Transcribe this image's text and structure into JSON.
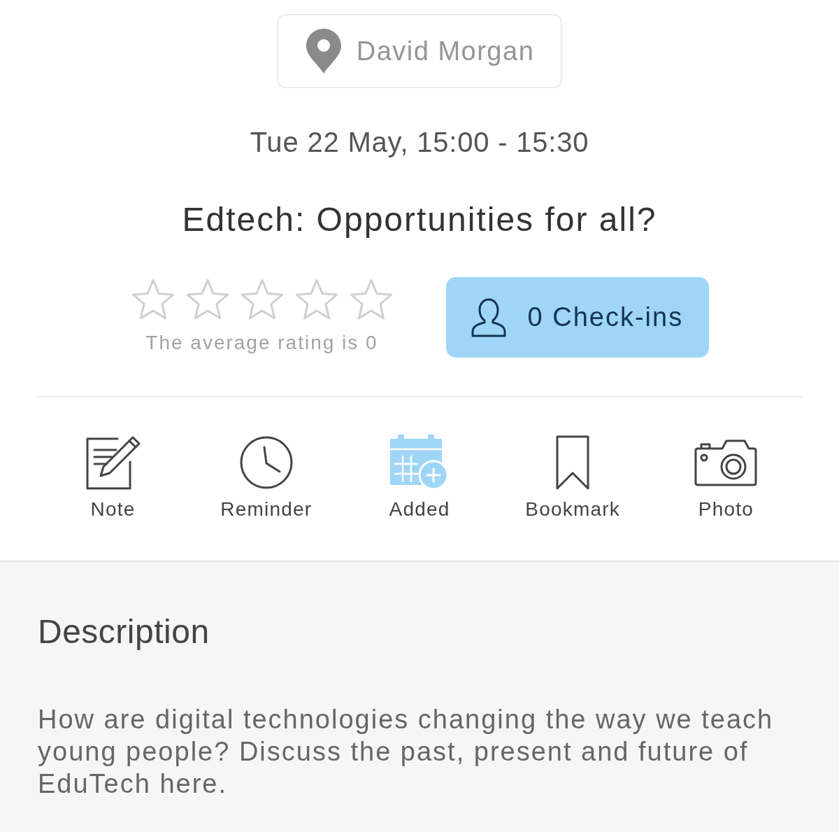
{
  "location_button": {
    "label": "David Morgan"
  },
  "date_time": "Tue 22 May, 15:00 - 15:30",
  "title": "Edtech: Opportunities for all?",
  "rating": {
    "stars": 0,
    "caption": "The average rating is 0"
  },
  "checkins_button": {
    "label": "0 Check-ins"
  },
  "actions": [
    {
      "kind": "note",
      "label": "Note",
      "active": false
    },
    {
      "kind": "reminder",
      "label": "Reminder",
      "active": false
    },
    {
      "kind": "calendar",
      "label": "Added",
      "active": true
    },
    {
      "kind": "bookmark",
      "label": "Bookmark",
      "active": false
    },
    {
      "kind": "photo",
      "label": "Photo",
      "active": false
    }
  ],
  "description": {
    "heading": "Description",
    "text": "How are digital technologies changing the way we teach young people? Discuss the past, present and future of EduTech here."
  }
}
